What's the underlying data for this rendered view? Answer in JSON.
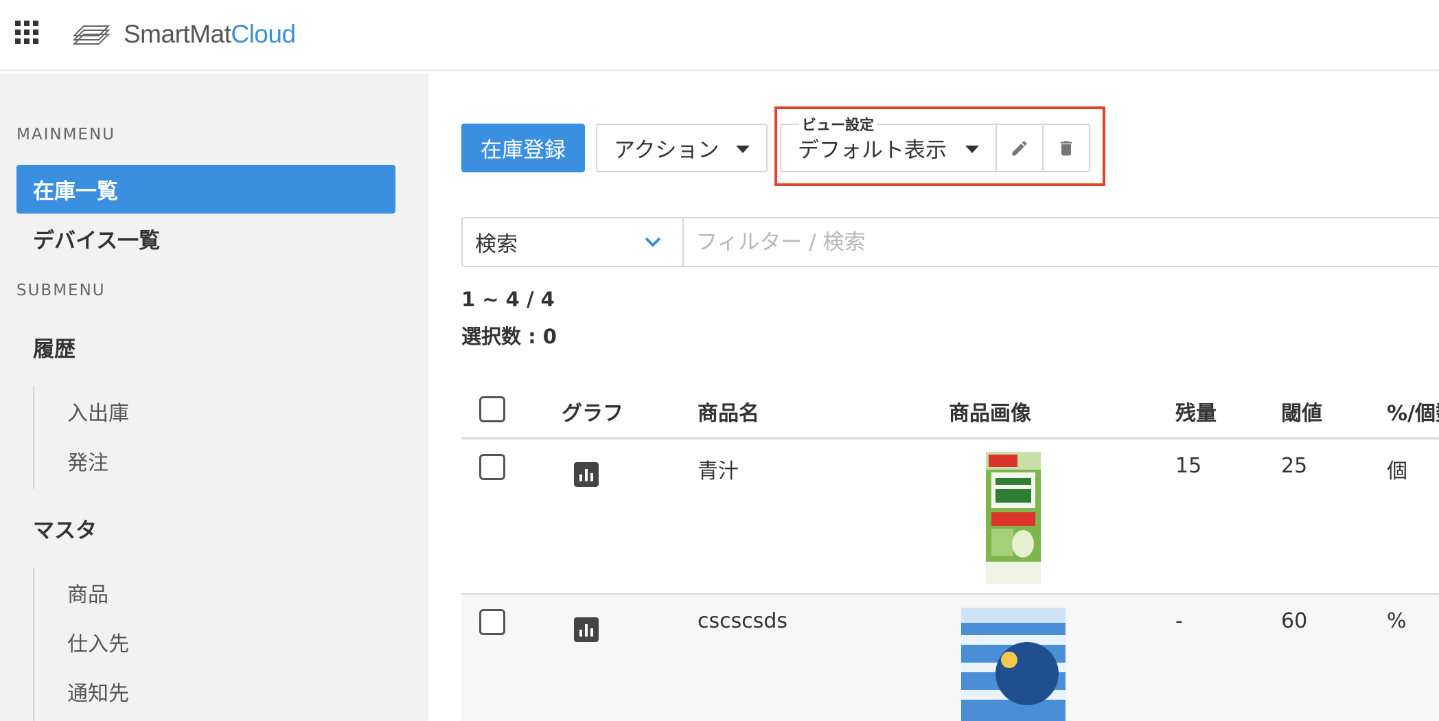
{
  "header": {
    "logo_main": "SmartMat",
    "logo_accent": "Cloud"
  },
  "sidebar": {
    "main_label": "MAINMENU",
    "main_items": [
      "在庫一覧",
      "デバイス一覧"
    ],
    "sub_label": "SUBMENU",
    "groups": [
      {
        "label": "履歴",
        "items": [
          "入出庫",
          "発注"
        ]
      },
      {
        "label": "マスタ",
        "items": [
          "商品",
          "仕入先",
          "通知先"
        ]
      }
    ]
  },
  "toolbar": {
    "register_label": "在庫登録",
    "action_label": "アクション",
    "view_legend": "ビュー設定",
    "view_value": "デフォルト表示",
    "edit_icon": "pencil-icon",
    "delete_icon": "trash-icon"
  },
  "search": {
    "select_value": "検索",
    "placeholder": "フィルター / 検索"
  },
  "counts": {
    "range": "1 ~ 4 / 4",
    "selected": "選択数 : 0"
  },
  "table": {
    "columns": [
      "グラフ",
      "商品名",
      "商品画像",
      "残量",
      "閾値",
      "%/個数"
    ],
    "rows": [
      {
        "name": "青汁",
        "remaining": "15",
        "threshold": "25",
        "unit": "個",
        "image": "aojiru-carton"
      },
      {
        "name": "cscscsds",
        "remaining": "-",
        "threshold": "60",
        "unit": "%",
        "image": "tissue-box"
      }
    ]
  },
  "colors": {
    "accent": "#3a8fe0",
    "highlight_border": "#e5412b",
    "sidebar_bg": "#f2f2f2"
  }
}
